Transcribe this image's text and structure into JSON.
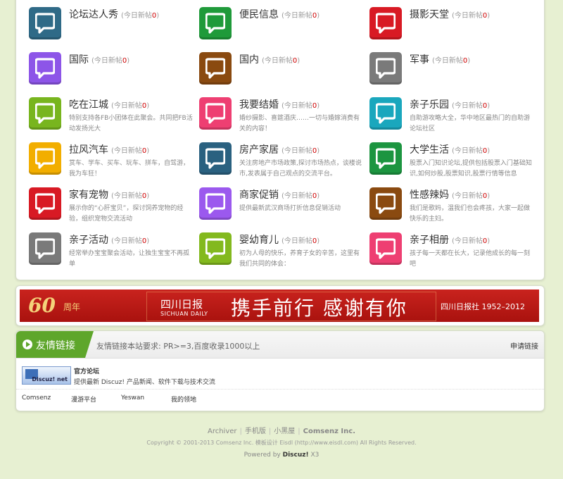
{
  "forums": [
    {
      "name": "论坛达人秀",
      "today_label": "(今日新帖",
      "count": "0",
      "close": ")",
      "desc": "",
      "color": "#2f6a87"
    },
    {
      "name": "便民信息",
      "today_label": "(今日新帖",
      "count": "0",
      "close": ")",
      "desc": "",
      "color": "#1f9a3a"
    },
    {
      "name": "摄影天堂",
      "today_label": "(今日新帖",
      "count": "0",
      "close": ")",
      "desc": "",
      "color": "#d81a24"
    },
    {
      "name": "国际",
      "today_label": "(今日新帖",
      "count": "0",
      "close": ")",
      "desc": "",
      "color": "#8d55e8"
    },
    {
      "name": "国内",
      "today_label": "(今日新帖",
      "count": "0",
      "close": ")",
      "desc": "",
      "color": "#8a4a10"
    },
    {
      "name": "军事",
      "today_label": "(今日新帖",
      "count": "0",
      "close": ")",
      "desc": "",
      "color": "#7a7a7a"
    },
    {
      "name": "吃在江城",
      "today_label": "(今日新帖",
      "count": "0",
      "close": ")",
      "desc": "特别支持各FB小团体在此聚会。共同把FB活动发扬光大",
      "color": "#78b51e"
    },
    {
      "name": "我要结婚",
      "today_label": "(今日新帖",
      "count": "0",
      "close": ")",
      "desc": "婚纱摄影、喜筵酒庆……一切与婚嫁消费有关的内容！",
      "color": "#ee3f72"
    },
    {
      "name": "亲子乐园",
      "today_label": "(今日新帖",
      "count": "0",
      "close": ")",
      "desc": "自助游攻略大全，华中地区最热门的自助游论坛社区",
      "color": "#1aa7bd"
    },
    {
      "name": "拉风汽车",
      "today_label": "(今日新帖",
      "count": "0",
      "close": ")",
      "desc": "赏车、学车、买车、玩车、拼车，自驾游，我为车狂！",
      "color": "#f2ae00"
    },
    {
      "name": "房产家居",
      "today_label": "(今日新帖",
      "count": "0",
      "close": ")",
      "desc": "关注房地产市场政策,探讨市场热点，谈楼说市,发表属于自己观点的交流平台。",
      "color": "#2a6180"
    },
    {
      "name": "大学生活",
      "today_label": "(今日新帖",
      "count": "0",
      "close": ")",
      "desc": "股票入门知识论坛,提供包括股票入门基础知识,如何炒股,股票知识,股票行情等信息",
      "color": "#1c9540"
    },
    {
      "name": "家有宠物",
      "today_label": "(今日新帖",
      "count": "0",
      "close": ")",
      "desc": "展示你的“心肝宝贝”，探讨饲养宠物的经验，组织宠物交流活动",
      "color": "#d81a24"
    },
    {
      "name": "商家促销",
      "today_label": "(今日新帖",
      "count": "0",
      "close": ")",
      "desc": "提供最新武汉商场打折信息促销活动",
      "color": "#9b59ee"
    },
    {
      "name": "性感辣妈",
      "today_label": "(今日新帖",
      "count": "0",
      "close": ")",
      "desc": "我们是歌妈，温我们也会疼孩，大家一起做快乐的主妇。",
      "color": "#8a4a10"
    },
    {
      "name": "亲子活动",
      "today_label": "(今日新帖",
      "count": "0",
      "close": ")",
      "desc": "经常举办宝宝聚会活动，让独生宝宝不再孤单",
      "color": "#7a7a7a"
    },
    {
      "name": "婴幼育儿",
      "today_label": "(今日新帖",
      "count": "0",
      "close": ")",
      "desc": "初为人母的快乐，养育子女的辛苦，这里有我们共同的体会：",
      "color": "#83b91e"
    },
    {
      "name": "亲子相册",
      "today_label": "(今日新帖",
      "count": "0",
      "close": ")",
      "desc": "孩子每一天都在长大，记录他成长的每一刻吧",
      "color": "#ee3f72"
    }
  ],
  "banner": {
    "anniv_number": "60",
    "anniv_word": "周年",
    "paper_cn": "四川日报",
    "paper_en": "SICHUAN DAILY",
    "slogan": "携手前行 感谢有你",
    "date_text": "四川日报社 1952–2012"
  },
  "links": {
    "title": "友情链接",
    "requirement": "友情链接本站要求: PR>=3,百度收录1000以上",
    "apply": "申请链接",
    "featured": {
      "logo_text": "Discuz! net",
      "name": "官方论坛",
      "desc": "提供最新 Discuz! 产品新闻、软件下载与技术交流"
    },
    "text_links": [
      "Comsenz",
      "漫游平台",
      "Yeswan",
      "我的领地"
    ]
  },
  "footer": {
    "nav": [
      "Archiver",
      "手机版",
      "小黑屋"
    ],
    "company": "Comsenz Inc.",
    "copyright": "Copyright © 2001-2013 Comsenz Inc. 模板设计 Eisdl (http://www.eisdl.com) All Rights Reserved.",
    "powered_prefix": "Powered by",
    "powered_brand": "Discuz!",
    "powered_version": "X3"
  }
}
